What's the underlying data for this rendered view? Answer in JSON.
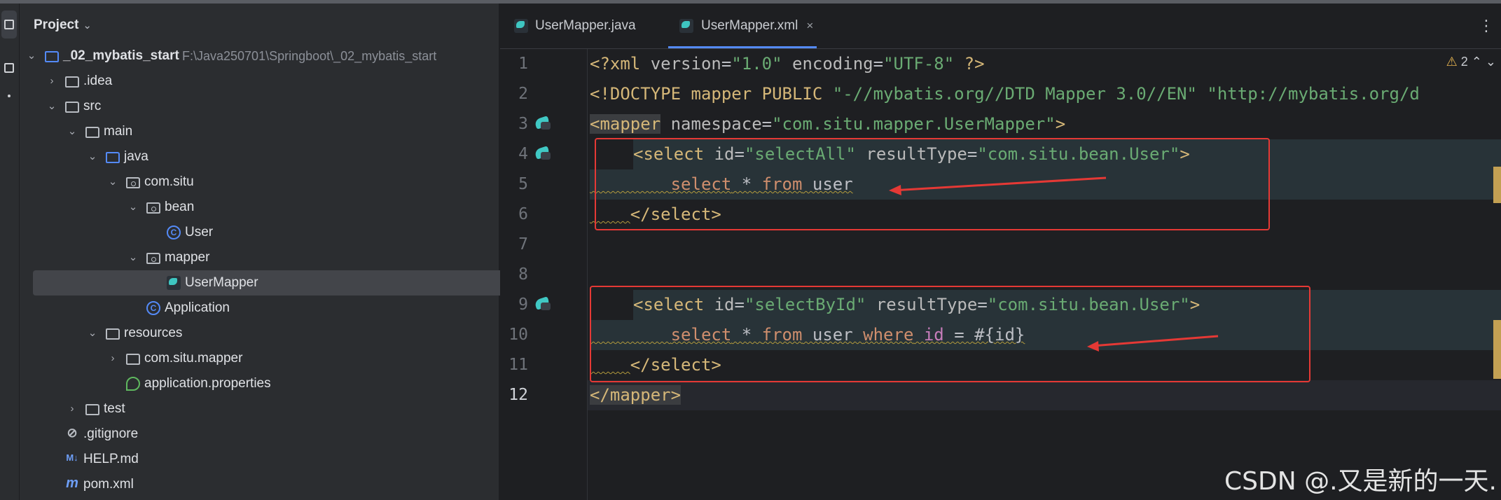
{
  "project": {
    "title": "Project",
    "tree": [
      {
        "label": "_02_mybatis_start",
        "path": "F:\\Java250701\\Springboot\\_02_mybatis_start",
        "icon": "module-folder-icon",
        "toggle": "⌄"
      },
      {
        "label": ".idea",
        "icon": "folder-icon",
        "toggle": "›"
      },
      {
        "label": "src",
        "icon": "folder-icon",
        "toggle": "⌄"
      },
      {
        "label": "main",
        "icon": "folder-icon",
        "toggle": "⌄"
      },
      {
        "label": "java",
        "icon": "source-folder-icon",
        "toggle": "⌄"
      },
      {
        "label": "com.situ",
        "icon": "package-icon",
        "toggle": "⌄"
      },
      {
        "label": "bean",
        "icon": "package-icon",
        "toggle": "⌄"
      },
      {
        "label": "User",
        "icon": "class-icon",
        "glyph": "C"
      },
      {
        "label": "mapper",
        "icon": "package-icon",
        "toggle": "⌄"
      },
      {
        "label": "UserMapper",
        "icon": "mybatis-icon"
      },
      {
        "label": "Application",
        "icon": "spring-class-icon",
        "glyph": "C"
      },
      {
        "label": "resources",
        "icon": "resources-folder-icon",
        "toggle": "⌄"
      },
      {
        "label": "com.situ.mapper",
        "icon": "folder-icon",
        "toggle": "›"
      },
      {
        "label": "application.properties",
        "icon": "spring-properties-icon"
      },
      {
        "label": "test",
        "icon": "folder-icon",
        "toggle": "›"
      },
      {
        "label": ".gitignore",
        "icon": "gitignore-icon",
        "glyph": "⊘"
      },
      {
        "label": "HELP.md",
        "icon": "markdown-icon",
        "glyph": "M↓"
      },
      {
        "label": "pom.xml",
        "icon": "maven-icon",
        "glyph": "m"
      }
    ]
  },
  "tabs": [
    {
      "label": "UserMapper.java",
      "active": false
    },
    {
      "label": "UserMapper.xml",
      "active": true,
      "close": "×"
    }
  ],
  "editor": {
    "warnings": "2",
    "line_numbers": [
      "1",
      "2",
      "3",
      "4",
      "5",
      "6",
      "7",
      "8",
      "9",
      "10",
      "11",
      "12"
    ],
    "code": {
      "l1": {
        "a": "<?xml ",
        "b": "version",
        "c": "=",
        "d": "\"1.0\"",
        "e": " encoding",
        "f": "=",
        "g": "\"UTF-8\"",
        "h": " ?>"
      },
      "l2": {
        "a": "<!DOCTYPE mapper PUBLIC ",
        "b": "\"-//mybatis.org//DTD Mapper 3.0//EN\"",
        "c": " ",
        "d": "\"http://mybatis.org/d"
      },
      "l3": {
        "a": "<mapper",
        "b": " namespace",
        "c": "=",
        "d": "\"com.situ.mapper.UserMapper\"",
        "e": ">"
      },
      "l4": {
        "a": "<select",
        "b": " id",
        "c": "=",
        "d": "\"selectAll\"",
        "e": " resultType",
        "f": "=",
        "g": "\"com.situ.bean.User\"",
        "h": ">"
      },
      "l5": {
        "a": "select",
        "b": " * ",
        "c": "from",
        "d": " user"
      },
      "l6": {
        "a": "</select>"
      },
      "l9": {
        "a": "<select",
        "b": " id",
        "c": "=",
        "d": "\"selectById\"",
        "e": " resultType",
        "f": "=",
        "g": "\"com.situ.bean.User\"",
        "h": ">"
      },
      "l10": {
        "a": "select",
        "b": " * ",
        "c": "from",
        "d": " user ",
        "e": "where",
        "f": " id",
        "g": " = ",
        "h": "#{id}"
      },
      "l11": {
        "a": "</select>"
      },
      "l12": {
        "a": "</mapper>"
      }
    }
  },
  "watermark": "CSDN @.又是新的一天.",
  "colors": {
    "accent": "#548af7",
    "annotation_red": "#e53935",
    "tag": "#d5b778",
    "string": "#6aab73",
    "keyword": "#cf8e6d"
  }
}
